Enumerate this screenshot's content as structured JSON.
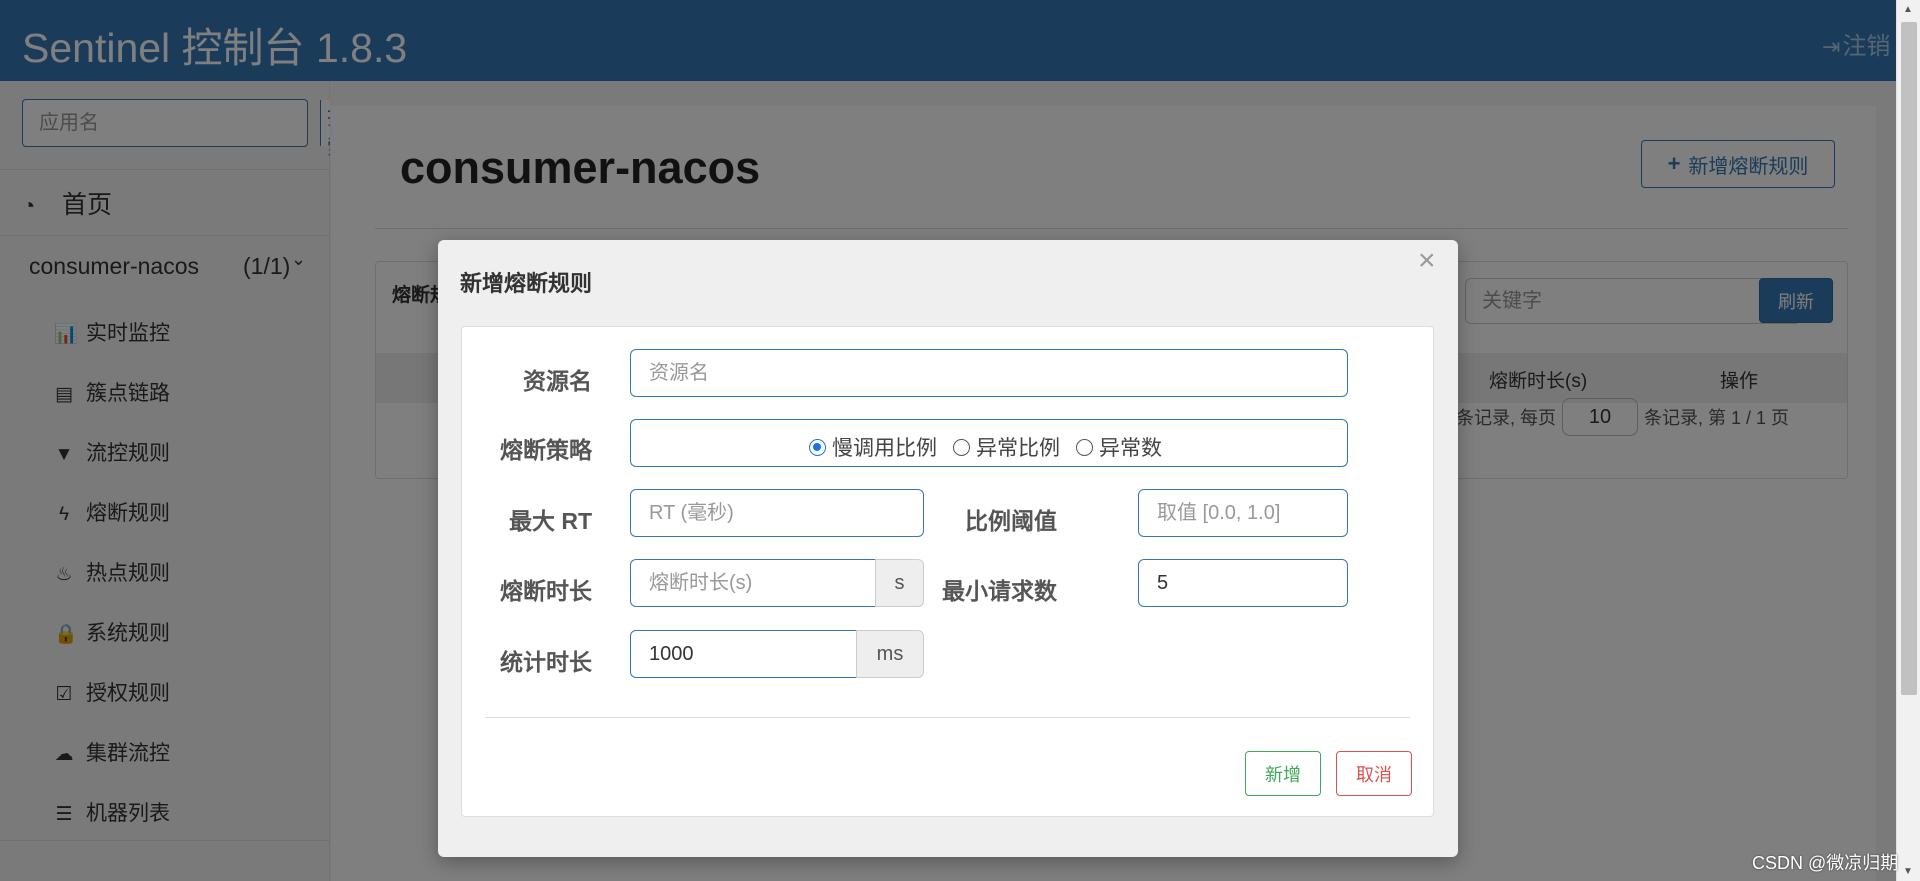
{
  "header": {
    "brand": "Sentinel 控制台 1.8.3",
    "logout_label": "注销",
    "logout_icon": "sign-out-icon"
  },
  "sidebar": {
    "search_placeholder": "应用名",
    "search_button": "搜索",
    "home_label": "首页",
    "home_icon": "dashboard-icon",
    "app": {
      "name": "consumer-nacos",
      "count": "(1/1)",
      "chevron": "chevron-down-icon"
    },
    "menu": [
      {
        "label": "实时监控",
        "icon": "bar-chart-icon",
        "glyph": "📊"
      },
      {
        "label": "簇点链路",
        "icon": "list-alt-icon",
        "glyph": "▤"
      },
      {
        "label": "流控规则",
        "icon": "filter-icon",
        "glyph": "▼"
      },
      {
        "label": "熔断规则",
        "icon": "flash-icon",
        "glyph": "ϟ"
      },
      {
        "label": "热点规则",
        "icon": "fire-icon",
        "glyph": "♨"
      },
      {
        "label": "系统规则",
        "icon": "lock-icon",
        "glyph": "🔒"
      },
      {
        "label": "授权规则",
        "icon": "check-icon",
        "glyph": "☑"
      },
      {
        "label": "集群流控",
        "icon": "cloud-icon",
        "glyph": "☁"
      },
      {
        "label": "机器列表",
        "icon": "th-list-icon",
        "glyph": "☰"
      }
    ]
  },
  "main": {
    "title": "consumer-nacos",
    "add_button": "新增熔断规则",
    "add_icon": "plus-icon",
    "table": {
      "panel_title": "熔断规则",
      "search_placeholder": "关键字",
      "refresh_button": "刷新",
      "columns": [
        "熔断时长(s)",
        "操作"
      ],
      "pager": {
        "prefix": "条记录, 每页",
        "page_size": "10",
        "suffix": "条记录, 第 1 / 1 页"
      }
    }
  },
  "modal": {
    "title": "新增熔断规则",
    "close_icon": "close-icon",
    "resource": {
      "label": "资源名",
      "placeholder": "资源名",
      "value": ""
    },
    "strategy": {
      "label": "熔断策略",
      "options": [
        "慢调用比例",
        "异常比例",
        "异常数"
      ],
      "selected": "慢调用比例"
    },
    "max_rt": {
      "label": "最大 RT",
      "placeholder": "RT (毫秒)",
      "value": ""
    },
    "ratio": {
      "label": "比例阈值",
      "placeholder": "取值 [0.0, 1.0]",
      "value": ""
    },
    "duration": {
      "label": "熔断时长",
      "placeholder": "熔断时长(s)",
      "value": "",
      "unit": "s"
    },
    "min_request": {
      "label": "最小请求数",
      "value": "5"
    },
    "stat_interval": {
      "label": "统计时长",
      "value": "1000",
      "unit": "ms"
    },
    "save_button": "新增",
    "cancel_button": "取消"
  },
  "watermark": "CSDN @微凉归期",
  "colors": {
    "navbar": "#3477b5",
    "primary": "#3477b5",
    "success": "#3fa85a",
    "danger": "#d9534f"
  }
}
